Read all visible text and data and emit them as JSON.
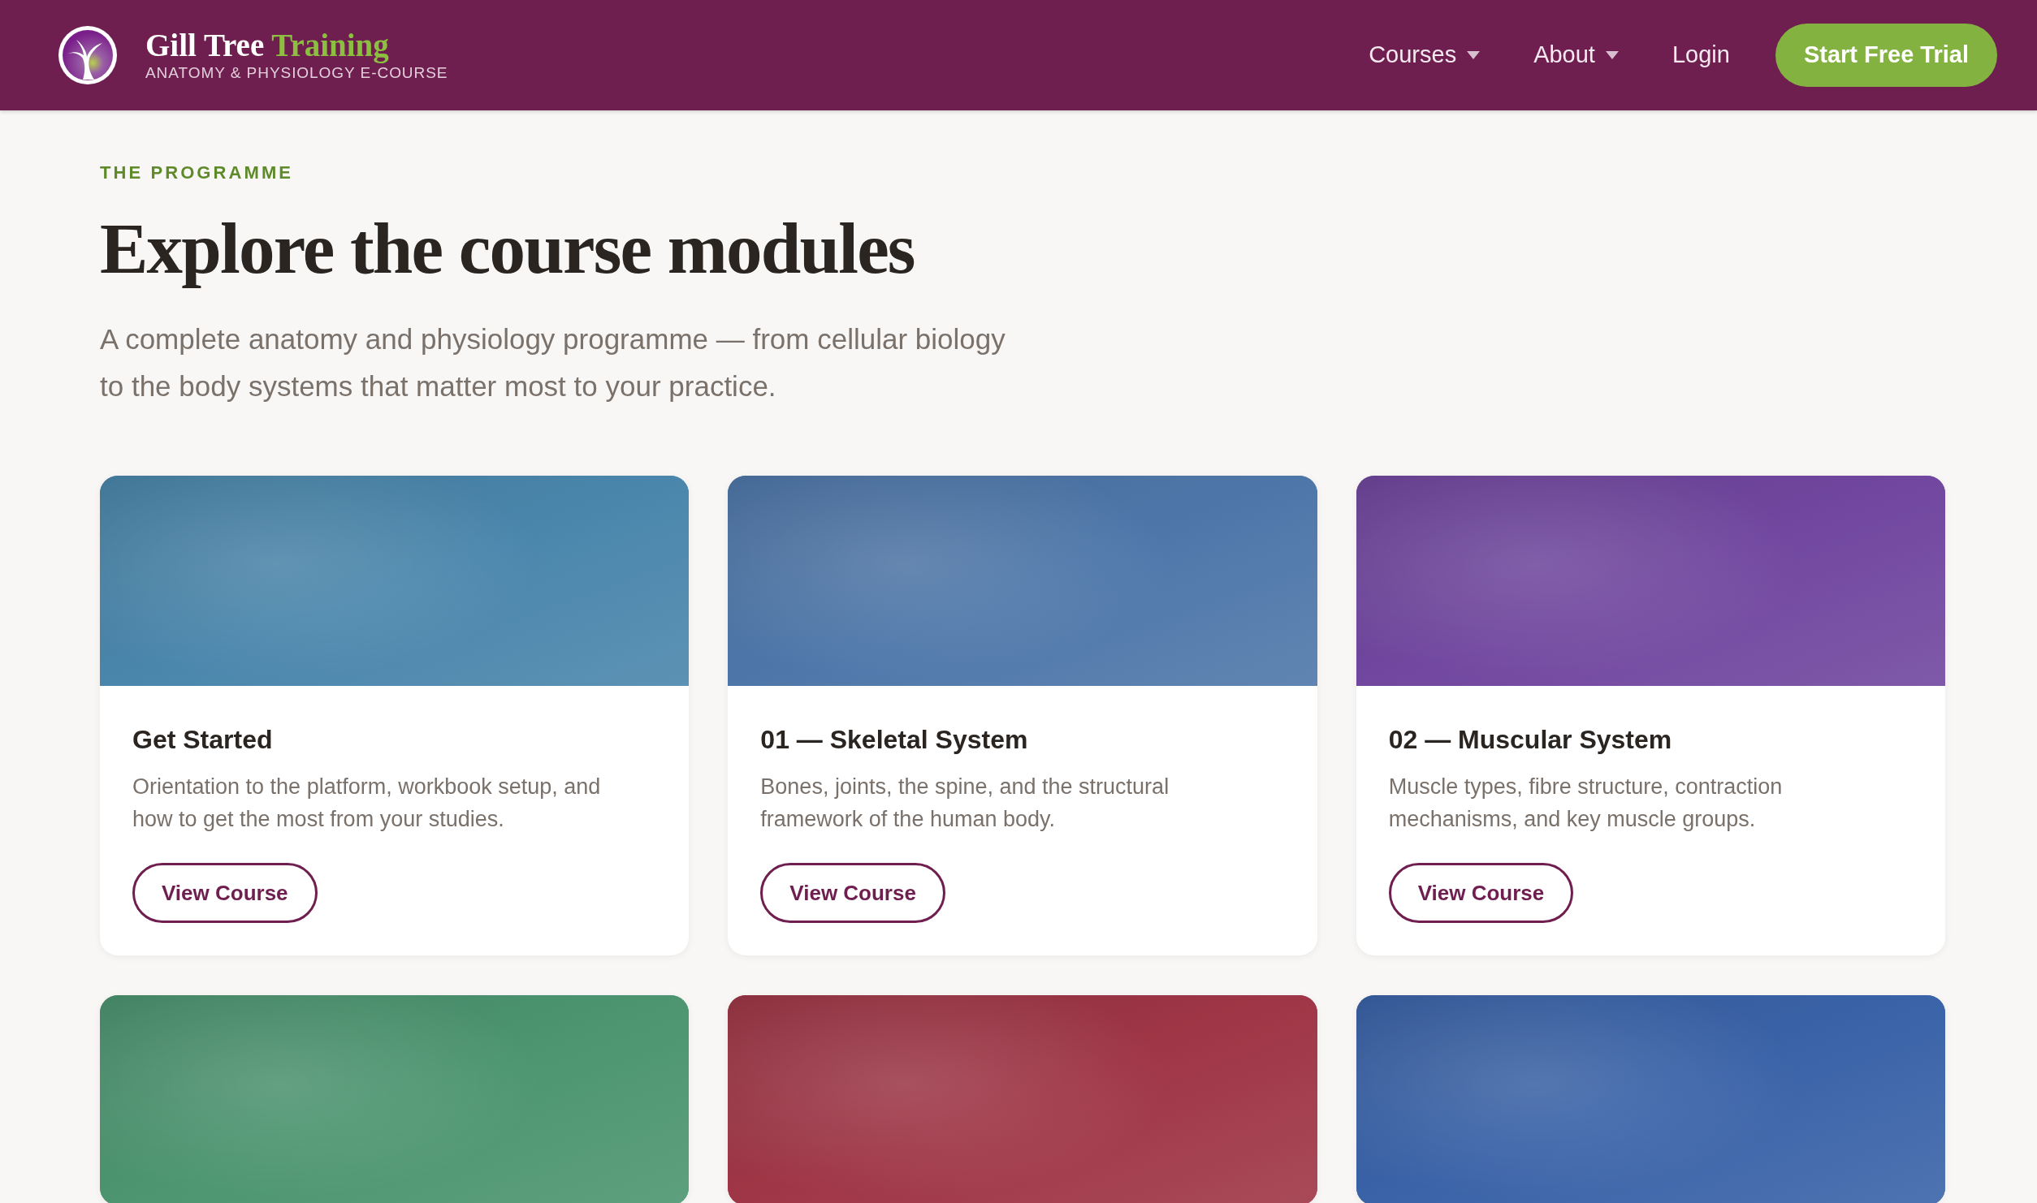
{
  "header": {
    "brand": {
      "name": "Gill Tree",
      "name_accent": "Training",
      "tagline": "ANATOMY & PHYSIOLOGY E-COURSE"
    },
    "nav": [
      {
        "label": "Courses",
        "dropdown": true
      },
      {
        "label": "About",
        "dropdown": true
      },
      {
        "label": "Login",
        "dropdown": false
      }
    ],
    "cta": "Start Free Trial"
  },
  "intro": {
    "eyebrow": "THE PROGRAMME",
    "title": "Explore the course modules",
    "lead": "A complete anatomy and physiology programme — from cellular biology to the body systems that matter most to your practice."
  },
  "modules": [
    {
      "color": "#4a86ac",
      "title": "Get Started",
      "description": "Orientation to the platform, workbook setup, and how to get the most from your studies.",
      "button": "View Course"
    },
    {
      "color": "#4e77a9",
      "title": "01 — Skeletal System",
      "description": "Bones, joints, the spine, and the structural framework of the human body.",
      "button": "View Course"
    },
    {
      "color": "#71479f",
      "title": "02 — Muscular System",
      "description": "Muscle types, fibre structure, contraction mechanisms, and key muscle groups.",
      "button": "View Course"
    },
    {
      "color": "#4c9570"
    },
    {
      "color": "#9f3647"
    },
    {
      "color": "#3a63a8"
    }
  ]
}
